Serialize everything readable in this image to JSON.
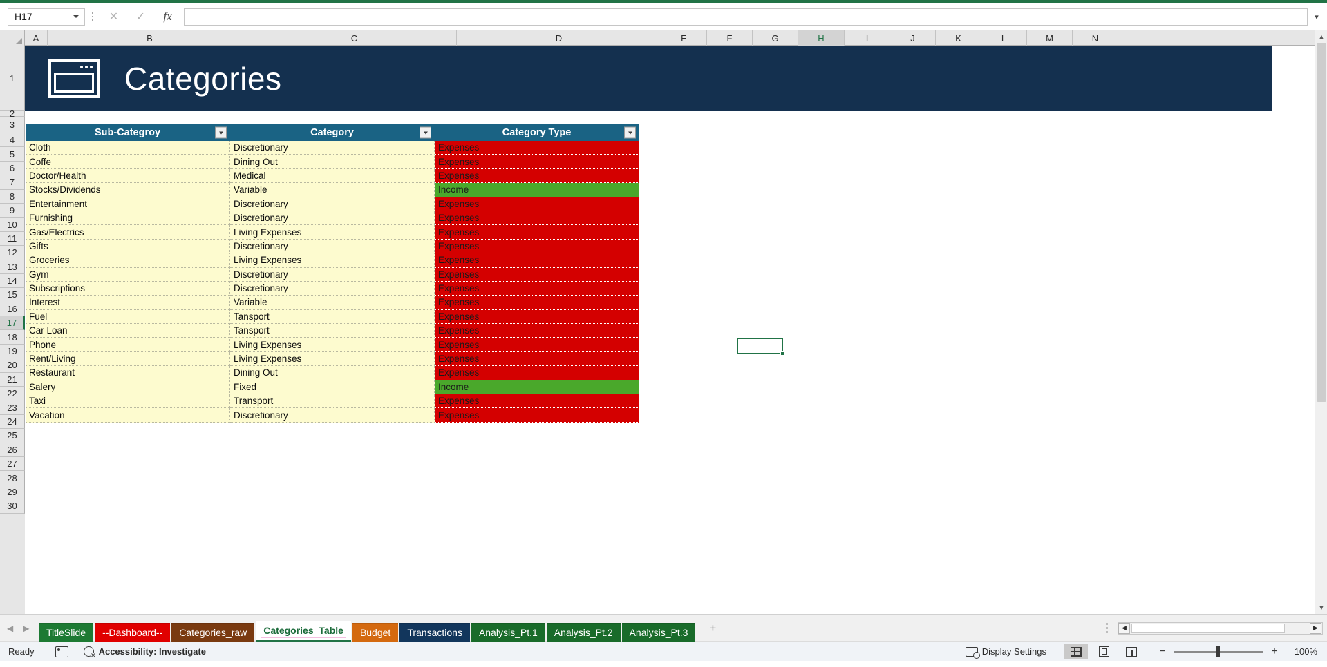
{
  "formula_bar": {
    "name_box_value": "H17",
    "formula_value": "",
    "cancel_icon": "close-icon",
    "confirm_icon": "check-icon",
    "function_icon": "fx-icon"
  },
  "grid": {
    "columns": [
      "A",
      "B",
      "C",
      "D",
      "E",
      "F",
      "G",
      "H",
      "I",
      "J",
      "K",
      "L",
      "M",
      "N"
    ],
    "selected_column": "H",
    "rows": [
      "1",
      "2",
      "3",
      "4",
      "5",
      "6",
      "7",
      "8",
      "9",
      "10",
      "11",
      "12",
      "13",
      "14",
      "15",
      "16",
      "17",
      "18",
      "19",
      "20",
      "21",
      "22",
      "23",
      "24",
      "25",
      "26",
      "27",
      "28",
      "29",
      "30"
    ],
    "selected_row": "17"
  },
  "banner": {
    "title": "Categories",
    "icon": "window-icon",
    "bg_color": "#14304f"
  },
  "table": {
    "headers": [
      "Sub-Categroy",
      "Category",
      "Category Type"
    ],
    "header_bg": "#1a6384",
    "row_bg": "#fdfbcf",
    "expenses_color": "#d40000",
    "income_color": "#4aa82b",
    "rows": [
      {
        "sub_category": "Cloth",
        "category": "Discretionary",
        "type": "Expenses"
      },
      {
        "sub_category": "Coffe",
        "category": "Dining Out",
        "type": "Expenses"
      },
      {
        "sub_category": "Doctor/Health",
        "category": "Medical",
        "type": "Expenses"
      },
      {
        "sub_category": "Stocks/Dividends",
        "category": "Variable",
        "type": "Income"
      },
      {
        "sub_category": "Entertainment",
        "category": "Discretionary",
        "type": "Expenses"
      },
      {
        "sub_category": "Furnishing",
        "category": "Discretionary",
        "type": "Expenses"
      },
      {
        "sub_category": "Gas/Electrics",
        "category": "Living Expenses",
        "type": "Expenses"
      },
      {
        "sub_category": "Gifts",
        "category": "Discretionary",
        "type": "Expenses"
      },
      {
        "sub_category": "Groceries",
        "category": "Living Expenses",
        "type": "Expenses"
      },
      {
        "sub_category": "Gym",
        "category": "Discretionary",
        "type": "Expenses"
      },
      {
        "sub_category": "Subscriptions",
        "category": "Discretionary",
        "type": "Expenses"
      },
      {
        "sub_category": "Interest",
        "category": "Variable",
        "type": "Expenses"
      },
      {
        "sub_category": "Fuel",
        "category": "Tansport",
        "type": "Expenses"
      },
      {
        "sub_category": "Car Loan",
        "category": "Tansport",
        "type": "Expenses"
      },
      {
        "sub_category": "Phone",
        "category": "Living Expenses",
        "type": "Expenses"
      },
      {
        "sub_category": "Rent/Living",
        "category": "Living Expenses",
        "type": "Expenses"
      },
      {
        "sub_category": "Restaurant",
        "category": "Dining Out",
        "type": "Expenses"
      },
      {
        "sub_category": "Salery",
        "category": "Fixed",
        "type": "Income"
      },
      {
        "sub_category": "Taxi",
        "category": "Transport",
        "type": "Expenses"
      },
      {
        "sub_category": "Vacation",
        "category": "Discretionary",
        "type": "Expenses"
      }
    ]
  },
  "sheet_tabs": {
    "add_label": "+",
    "prev_icon": "chevron-left-icon",
    "next_icon": "chevron-right-icon",
    "items": [
      {
        "label": "TitleSlide",
        "color": "#1d7a33",
        "active": false
      },
      {
        "label": "--Dashboard--",
        "color": "#e00000",
        "active": false
      },
      {
        "label": "Categories_raw",
        "color": "#7a3a10",
        "active": false
      },
      {
        "label": "Categories_Table",
        "color": "#ffffff",
        "active": true
      },
      {
        "label": "Budget",
        "color": "#d4690f",
        "active": false
      },
      {
        "label": "Transactions",
        "color": "#12365c",
        "active": false
      },
      {
        "label": "Analysis_Pt.1",
        "color": "#196b2a",
        "active": false
      },
      {
        "label": "Analysis_Pt.2",
        "color": "#196b2a",
        "active": false
      },
      {
        "label": "Analysis_Pt.3",
        "color": "#196b2a",
        "active": false
      }
    ]
  },
  "status_bar": {
    "ready_label": "Ready",
    "macro_icon": "record-macro-icon",
    "accessibility_label": "Accessibility: Investigate",
    "accessibility_icon": "accessibility-icon",
    "display_settings_label": "Display Settings",
    "display_settings_icon": "display-settings-icon",
    "view_normal": "normal-view",
    "view_page_layout": "page-layout-view",
    "view_page_break": "page-break-view",
    "zoom_out": "−",
    "zoom_in": "+",
    "zoom_level": "100%"
  }
}
